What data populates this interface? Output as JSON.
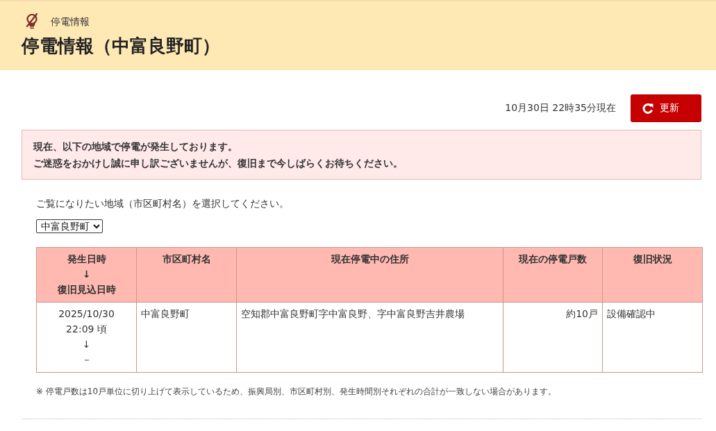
{
  "header": {
    "breadcrumb": "停電情報",
    "title": "停電情報（中富良野町）"
  },
  "status": {
    "updated_at": "10月30日 22時35分現在",
    "refresh_button": "更新"
  },
  "notice": {
    "lines": [
      "現在、以下の地域で停電が発生しております。",
      "ご迷惑をおかけし誠に申し訳ございませんが、復旧まで今しばらくお待ちください。"
    ]
  },
  "area_select": {
    "instruction": "ご覧になりたい地域（市区町村名）を選択してください。",
    "value": "中富良野町"
  },
  "table": {
    "columns": [
      {
        "lines": [
          "発生日時",
          "↓",
          "復旧見込日時"
        ]
      },
      {
        "lines": [
          "市区町村名"
        ]
      },
      {
        "lines": [
          "現在停電中の住所"
        ]
      },
      {
        "lines": [
          "現在の停電戸数"
        ]
      },
      {
        "lines": [
          "復旧状況"
        ]
      }
    ],
    "rows": [
      {
        "cells": [
          {
            "lines": [
              "2025/10/30",
              "22:09 頃",
              "↓",
              "－"
            ]
          },
          {
            "lines": [
              "中富良野町"
            ]
          },
          {
            "lines": [
              "空知郡中富良野町字中富良野、字中富良野吉井農場"
            ]
          },
          {
            "lines": [
              "約10戸"
            ]
          },
          {
            "lines": [
              "設備確認中"
            ]
          }
        ]
      }
    ]
  },
  "footnote": "※ 停電戸数は10戸単位に切り上げて表示しているため、振興局別、市区町村別、発生時間別それぞれの合計が一致しない場合があります。"
}
